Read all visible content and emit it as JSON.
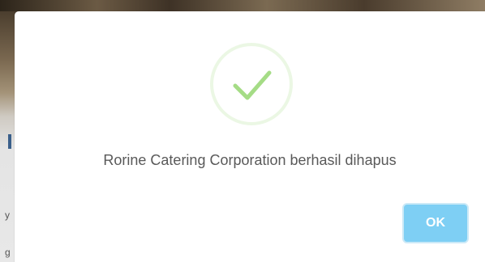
{
  "dialog": {
    "icon": "success-check-icon",
    "message": "Rorine Catering Corporation berhasil dihapus",
    "ok_label": "OK"
  },
  "background": {
    "edge_glyphs": [
      "y",
      "g"
    ]
  },
  "colors": {
    "check": "#a5dc86",
    "ok_button": "#7ecff4",
    "ok_button_border": "#cbe9f7",
    "message_text": "#595959"
  }
}
